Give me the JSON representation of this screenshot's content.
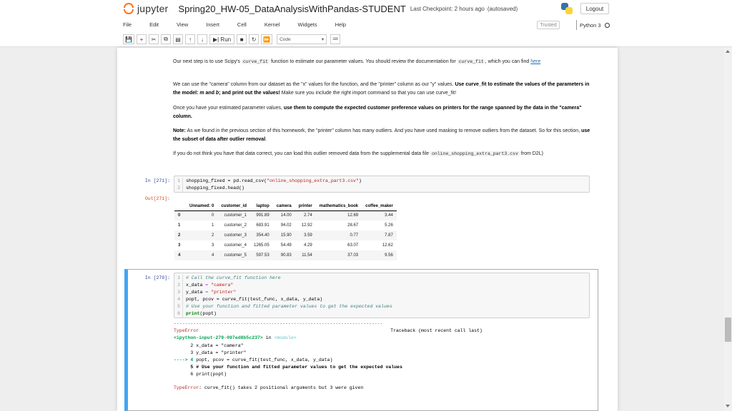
{
  "header": {
    "brand": "jupyter",
    "notebook_name": "Spring20_HW-05_DataAnalysisWithPandas-STUDENT",
    "checkpoint": "Last Checkpoint: 2 hours ago",
    "autosave": "(autosaved)",
    "logout_label": "Logout"
  },
  "menu": {
    "items": [
      "File",
      "Edit",
      "View",
      "Insert",
      "Cell",
      "Kernel",
      "Widgets",
      "Help"
    ],
    "trusted": "Trusted",
    "kernel": "Python 3"
  },
  "toolbar": {
    "run_label": "Run",
    "cell_type": "Code",
    "icons": [
      "save-icon",
      "add-cell-icon",
      "cut-icon",
      "copy-icon",
      "paste-icon",
      "move-up-icon",
      "move-down-icon",
      "run-icon",
      "stop-icon",
      "restart-icon",
      "fast-forward-icon",
      "keyboard-icon"
    ]
  },
  "markdown": {
    "p1_a": "Our next step is to use Scipy's ",
    "p1_code": "curve_fit",
    "p1_b": " function to estimate our parameter values. You should review the documentation for ",
    "p1_code2": "curve_fit",
    "p1_c": ", which you can find ",
    "p1_link": "here",
    "p2_a": "We can use the \"camera\" column from our dataset as the \"x\" values for the function, and the \"printer\" column as our \"y\" values. ",
    "p2_bold": "Use curve_fit to estimate the values of the parameters in the model: ",
    "p2_m": "m",
    "p2_and": " and ",
    "p2_b_var": "b",
    "p2_bold2": "; and print out the values!",
    "p2_c": " Make sure you include the right import command so that you can use curve_fit!",
    "p3_a": "Once you have your estimated parameter values, ",
    "p3_bold": "use them to compute the expected customer preference values on printers for the range spanned by the data in the \"camera\" column.",
    "p4_note": "Note:",
    "p4_a": " As we found in the previous section of this homework, the \"printer\" column has many outliers. And you have used masking to remove outliers from the dataset. So for this section, ",
    "p4_bold": "use the subset of data after outlier removal",
    "p4_end": ".",
    "p5_a": "If you do not think you have that data correct, you can load this outlier removed data from the supplemental data file ",
    "p5_code": "online_shopping_extra_part3.csv",
    "p5_b": " from D2L)"
  },
  "cell1": {
    "in_prompt": "In [271]:",
    "out_prompt": "Out[271]:",
    "line_numbers": [
      "1",
      "2"
    ],
    "line1_var": "shopping_fixed",
    "line1_eq": " = pd.read_csv(",
    "line1_str": "\"online_shopping_extra_part3.csv\"",
    "line1_end": ")",
    "line2": "shopping_fixed.head()"
  },
  "dataframe": {
    "columns": [
      "",
      "Unnamed: 0",
      "customer_id",
      "laptop",
      "camera",
      "printer",
      "mathematics_book",
      "coffee_maker"
    ],
    "rows": [
      [
        "0",
        "0",
        "customer_1",
        "991.89",
        "14.00",
        "2.74",
        "12.69",
        "3.44"
      ],
      [
        "1",
        "1",
        "customer_2",
        "683.91",
        "94.02",
        "12.92",
        "28.67",
        "5.26"
      ],
      [
        "2",
        "2",
        "customer_3",
        "354.40",
        "15.90",
        "3.59",
        "0.77",
        "7.87"
      ],
      [
        "3",
        "3",
        "customer_4",
        "1265.05",
        "54.49",
        "4.29",
        "63.07",
        "12.62"
      ],
      [
        "4",
        "4",
        "customer_5",
        "597.53",
        "90.83",
        "11.54",
        "37.03",
        "9.56"
      ]
    ]
  },
  "cell2": {
    "in_prompt": "In [279]:",
    "line_numbers": [
      "1",
      "2",
      "3",
      "4",
      "5",
      "6"
    ],
    "l1_comment": "# Call the curve_fit function here",
    "l2_var": "x_data",
    "l2_eq": " = ",
    "l2_str": "\"camera\"",
    "l3_var": "y_data",
    "l3_eq": " = ",
    "l3_str": "\"printer\"",
    "l4": "popt, pcov = curve_fit(test_func, x_data, y_data)",
    "l5_comment": "# Use your function and fitted parameter values to get the expected values",
    "l6_kw": "print",
    "l6_rest": "(popt)"
  },
  "error": {
    "separator": "---------------------------------------------------------------------------",
    "name": "TypeError",
    "traceback_label": "Traceback (most recent call last)",
    "input_ref": "<ipython-input-279-097ed8b5c237>",
    "in_word": " in ",
    "module": "<module>",
    "tl1": "      2 x_data = \"camera\"",
    "tl2": "      3 y_data = \"printer\"",
    "tl3_arrow": "----> 4 ",
    "tl3_code": "popt, pcov = curve_fit(test_func, x_data, y_data)",
    "tl4": "      5 # Use your function and fitted parameter values to get the expected values",
    "tl5": "      6 print(popt)",
    "final_name": "TypeError",
    "final_msg": ": curve_fit() takes 2 positional arguments but 3 were given"
  }
}
